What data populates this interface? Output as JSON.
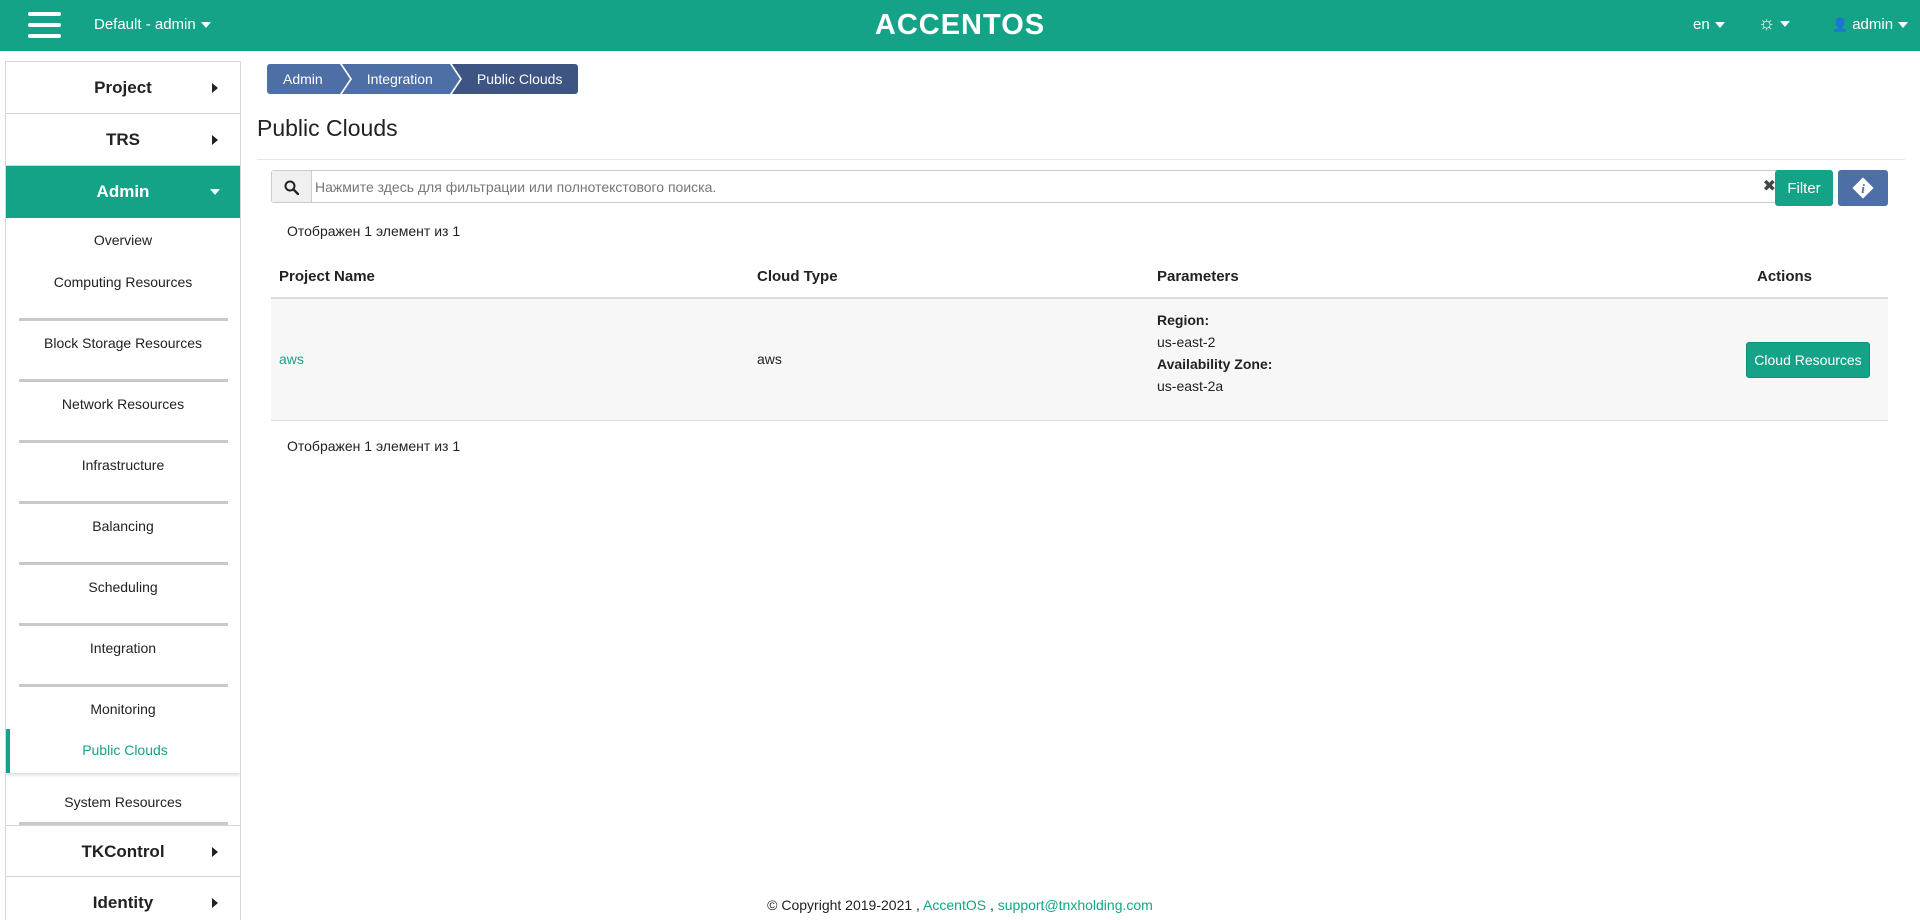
{
  "header": {
    "project_selector": "Default - admin",
    "logo": "ACCENTOS",
    "language": "en",
    "user": "admin",
    "accent_color": "#15a387"
  },
  "sidebar": {
    "sections_top": [
      {
        "label": "Project"
      },
      {
        "label": "TRS"
      }
    ],
    "active_section": "Admin",
    "admin_items": [
      "Overview",
      "Computing Resources",
      "Block Storage Resources",
      "Network Resources",
      "Infrastructure",
      "Balancing",
      "Scheduling",
      "Integration",
      "Monitoring",
      "Public Clouds",
      "System Resources"
    ],
    "sections_bottom": [
      {
        "label": "TKControl"
      },
      {
        "label": "Identity"
      }
    ]
  },
  "breadcrumb": [
    "Admin",
    "Integration",
    "Public Clouds"
  ],
  "page_title": "Public Clouds",
  "search": {
    "placeholder": "Нажмите здесь для фильтрации или полнотекстового поиска.",
    "filter_label": "Filter"
  },
  "count_text": "Отображен 1 элемент из 1",
  "table": {
    "columns": [
      "Project Name",
      "Cloud Type",
      "Parameters",
      "Actions"
    ],
    "rows": [
      {
        "project_name": "aws",
        "cloud_type": "aws",
        "region_label": "Region:",
        "region_value": "us-east-2",
        "zone_label": "Availability Zone:",
        "zone_value": "us-east-2a",
        "action_label": "Cloud Resources"
      }
    ]
  },
  "footer": {
    "copyright": "© Copyright 2019-2021 ,",
    "brand_link": "AccentOS",
    "separator": ",",
    "email_link": "support@tnxholding.com"
  }
}
